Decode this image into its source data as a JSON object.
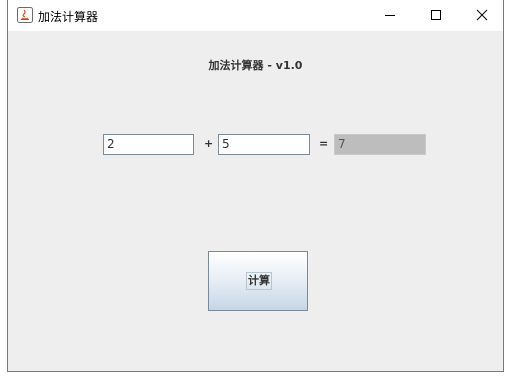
{
  "window": {
    "title": "加法计算器",
    "controls": {
      "minimize": "minimize-icon",
      "maximize": "maximize-icon",
      "close": "close-icon"
    }
  },
  "main": {
    "heading": "加法计算器 - v1.0",
    "operand_a": "2",
    "plus_sign": "+",
    "operand_b": "5",
    "equals_sign": "=",
    "result": "7",
    "calculate_label": "计算"
  },
  "colors": {
    "content_background": "#eeeeee",
    "result_background": "#bdbdbd",
    "button_gradient_bottom": "#c6d6e7"
  }
}
